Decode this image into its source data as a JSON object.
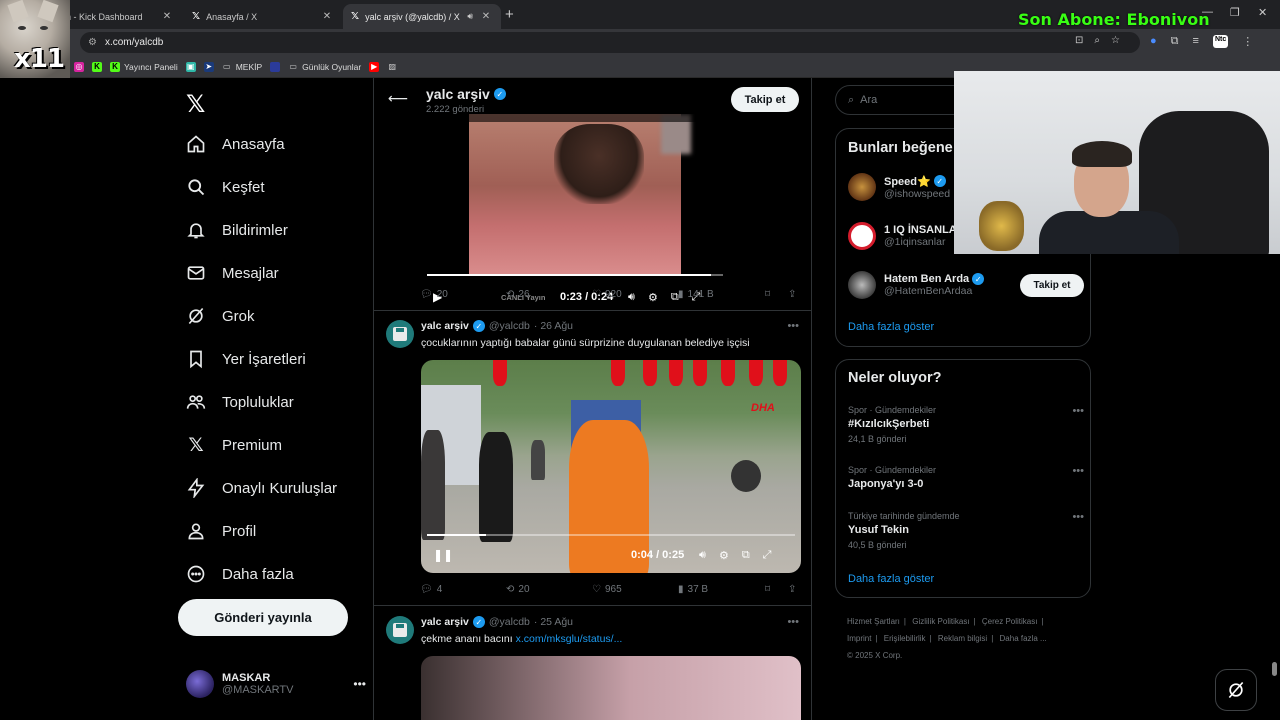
{
  "browser": {
    "tabs": [
      {
        "title": "n - Kick Dashboard",
        "active": false
      },
      {
        "title": "Anasayfa / X",
        "active": false
      },
      {
        "title": "yalc arşiv (@yalcdb) / X",
        "active": true
      }
    ],
    "url": "x.com/yalcdb",
    "bookmarks": [
      "Yayıncı Paneli",
      "MEKİP",
      "Günlük Oyunlar"
    ],
    "overlay_text": "Son Abone: Ebonivon",
    "cat_label": "x11"
  },
  "nav": {
    "items": [
      {
        "label": "Anasayfa",
        "icon": "home-icon"
      },
      {
        "label": "Keşfet",
        "icon": "search-icon"
      },
      {
        "label": "Bildirimler",
        "icon": "bell-icon"
      },
      {
        "label": "Mesajlar",
        "icon": "mail-icon"
      },
      {
        "label": "Grok",
        "icon": "grok-icon"
      },
      {
        "label": "Yer İşaretleri",
        "icon": "bookmark-icon"
      },
      {
        "label": "Topluluklar",
        "icon": "communities-icon"
      },
      {
        "label": "Premium",
        "icon": "x-icon"
      },
      {
        "label": "Onaylı Kuruluşlar",
        "icon": "lightning-icon"
      },
      {
        "label": "Profil",
        "icon": "person-icon"
      },
      {
        "label": "Daha fazla",
        "icon": "more-circle-icon"
      }
    ],
    "post_button": "Gönderi yayınla",
    "account": {
      "name": "MASKAR",
      "handle": "@MASKARTV"
    }
  },
  "profile_header": {
    "name": "yalc arşiv",
    "post_count": "2.222 gönderi",
    "follow": "Takip et"
  },
  "posts": [
    {
      "video": {
        "live_label": "CANLI Yayın",
        "time": "0:23 / 0:24",
        "progress": 0.96
      },
      "stats": {
        "replies": "20",
        "reposts": "26",
        "likes": "920",
        "views": "141 B"
      }
    },
    {
      "author": "yalc arşiv",
      "handle": "@yalcdb",
      "date": "· 26 Ağu",
      "text": "çocuklarının yaptığı babalar günü sürprizine duygulanan belediye işçisi",
      "video": {
        "time": "0:04 / 0:25",
        "progress": 0.16,
        "watermark": "DHA"
      },
      "stats": {
        "replies": "4",
        "reposts": "20",
        "likes": "965",
        "views": "37 B"
      }
    },
    {
      "author": "yalc arşiv",
      "handle": "@yalcdb",
      "date": "· 25 Ağu",
      "text": "çekme ananı bacını",
      "link": "x.com/mksglu/status/..."
    }
  ],
  "sidebar": {
    "search_placeholder": "Ara",
    "who_to_follow": {
      "title": "Bunları beğene",
      "users": [
        {
          "name": "Speed⭐",
          "handle": "@ishowspeed",
          "verified": true
        },
        {
          "name": "1 IQ İNSANLA",
          "handle": "@1iqinsanlar",
          "verified": false
        },
        {
          "name": "Hatem Ben Arda",
          "handle": "@HatemBenArdaa",
          "verified": true,
          "button": "Takip et"
        }
      ],
      "show_more": "Daha fazla göster"
    },
    "trends": {
      "title": "Neler oluyor?",
      "items": [
        {
          "category": "Spor · Gündemdekiler",
          "topic": "#KızılcıkŞerbeti",
          "posts": "24,1 B gönderi"
        },
        {
          "category": "Spor · Gündemdekiler",
          "topic": "Japonya'yı 3-0",
          "posts": ""
        },
        {
          "category": "Türkiye tarihinde gündemde",
          "topic": "Yusuf Tekin",
          "posts": "40,5 B gönderi"
        }
      ],
      "show_more": "Daha fazla göster"
    },
    "footer": [
      "Hizmet Şartları",
      "Gizlilik Politikası",
      "Çerez Politikası",
      "Imprint",
      "Erişilebilirlik",
      "Reklam bilgisi",
      "Daha fazla ...",
      "© 2025 X Corp."
    ]
  }
}
